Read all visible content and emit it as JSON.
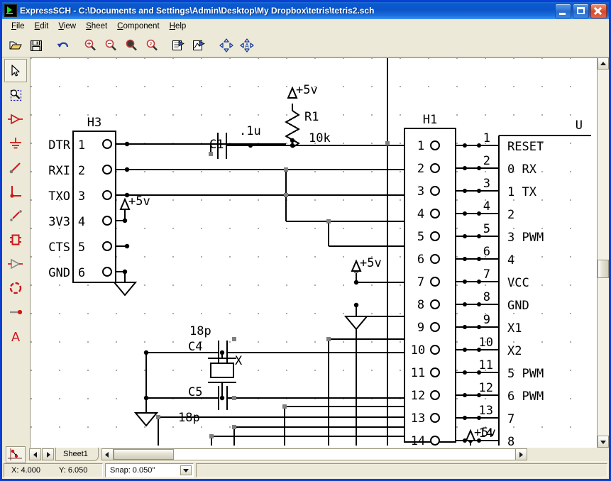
{
  "window": {
    "title": "ExpressSCH - C:\\Documents and Settings\\Admin\\Desktop\\My Dropbox\\tetris\\tetris2.sch",
    "app_name": "ExpressSCH",
    "icon": "expresssch-app-icon",
    "buttons": {
      "minimize": "minimize",
      "maximize": "maximize",
      "close": "close"
    },
    "accent": "#0a5ad0",
    "chrome_bg": "#ece9d8"
  },
  "menu": {
    "items": [
      {
        "label": "File",
        "accel": "F"
      },
      {
        "label": "Edit",
        "accel": "E"
      },
      {
        "label": "View",
        "accel": "V"
      },
      {
        "label": "Sheet",
        "accel": "S"
      },
      {
        "label": "Component",
        "accel": "C"
      },
      {
        "label": "Help",
        "accel": "H"
      }
    ]
  },
  "toolbar": {
    "buttons": [
      {
        "name": "open-icon",
        "title": "Open"
      },
      {
        "name": "save-icon",
        "title": "Save"
      },
      {
        "name": "undo-icon",
        "title": "Undo"
      },
      {
        "name": "zoom-in-icon",
        "title": "Zoom In"
      },
      {
        "name": "zoom-out-icon",
        "title": "Zoom Out"
      },
      {
        "name": "zoom-area-icon",
        "title": "Zoom to Area"
      },
      {
        "name": "zoom-page-icon",
        "title": "Zoom to Page"
      },
      {
        "name": "properties-icon",
        "title": "Properties"
      },
      {
        "name": "netlist-icon",
        "title": "Netlist"
      },
      {
        "name": "move-icon",
        "title": "Move"
      },
      {
        "name": "move-text-icon",
        "title": "Move Text"
      }
    ]
  },
  "left_toolbar": {
    "tools": [
      {
        "name": "select-arrow-icon",
        "title": "Select",
        "selected": true
      },
      {
        "name": "zoom-region-icon",
        "title": "Zoom Region",
        "selected": false
      },
      {
        "name": "place-component-icon",
        "title": "Place Component",
        "selected": false
      },
      {
        "name": "place-ground-icon",
        "title": "Place Ground",
        "selected": false
      },
      {
        "name": "place-wire-icon",
        "title": "Place Wire",
        "selected": false
      },
      {
        "name": "place-bus-icon",
        "title": "Place Bus",
        "selected": false
      },
      {
        "name": "place-line-icon",
        "title": "Place Line",
        "selected": false
      },
      {
        "name": "place-box-icon",
        "title": "Place Box",
        "selected": false
      },
      {
        "name": "place-port-icon",
        "title": "Place Port",
        "selected": false
      },
      {
        "name": "place-circle-icon",
        "title": "Place Circle",
        "selected": false
      },
      {
        "name": "place-pin-icon",
        "title": "Place Pin",
        "selected": false
      },
      {
        "name": "place-text-icon",
        "title": "Place Text",
        "selected": false
      }
    ]
  },
  "sheet_tabs": {
    "prev_label": "prev-sheet",
    "next_label": "next-sheet",
    "tabs": [
      {
        "label": "Sheet1",
        "active": true
      }
    ]
  },
  "status": {
    "x_label": "X: 4.000",
    "y_label": "Y: 6.050",
    "snap_label": "Snap:  0.050\"",
    "snap_value": "0.050\"",
    "corner_icon": "origin-icon"
  },
  "schematic": {
    "background": "#ffffff",
    "grid_color": "#8f8f8f",
    "grid_spacing_px": 40,
    "wire_color": "#000000",
    "handle_color": "#808080",
    "components": [
      {
        "ref": "H3",
        "type": "header",
        "pin_count": 6,
        "pin_numbers": [
          "1",
          "2",
          "3",
          "4",
          "5",
          "6"
        ],
        "pin_names": [
          "DTR",
          "RXI",
          "TXO",
          "3V3",
          "CTS",
          "GND"
        ]
      },
      {
        "ref": "H1",
        "type": "header",
        "pin_count": 14,
        "pin_numbers": [
          "1",
          "2",
          "3",
          "4",
          "5",
          "6",
          "7",
          "8",
          "9",
          "10",
          "11",
          "12",
          "13",
          "14"
        ]
      },
      {
        "ref": "U",
        "type": "ic",
        "pin_numbers": [
          "1",
          "2",
          "3",
          "4",
          "5",
          "6",
          "7",
          "8",
          "9",
          "10",
          "11",
          "12",
          "13",
          "14"
        ],
        "pin_names": [
          "RESET",
          "0  RX",
          "1  TX",
          "2",
          "3 PWM",
          "4",
          "VCC",
          "GND",
          "X1",
          "X2",
          "5 PWM",
          "6 PWM",
          "7",
          "8"
        ]
      },
      {
        "ref": "R1",
        "type": "resistor",
        "value": "10k"
      },
      {
        "ref": "C1",
        "type": "capacitor",
        "value": ".1u"
      },
      {
        "ref": "C4",
        "type": "capacitor",
        "value": "18p"
      },
      {
        "ref": "C5",
        "type": "capacitor",
        "value": "18p"
      },
      {
        "ref": "X",
        "type": "crystal",
        "value": ""
      }
    ],
    "net_labels": [
      "+5v",
      "+5v",
      "+5v",
      "+5v"
    ],
    "ground_symbols": 3,
    "labels": {
      "h3": "H3",
      "h1": "H1",
      "u": "U",
      "r1": "R1",
      "r1_val": "10k",
      "c1": "C1",
      "c1_val": ".1u",
      "c4": "C4",
      "c4_val": "18p",
      "c5": "C5",
      "c5_val": "18p",
      "xtal": "X",
      "v5": "+5v"
    }
  }
}
